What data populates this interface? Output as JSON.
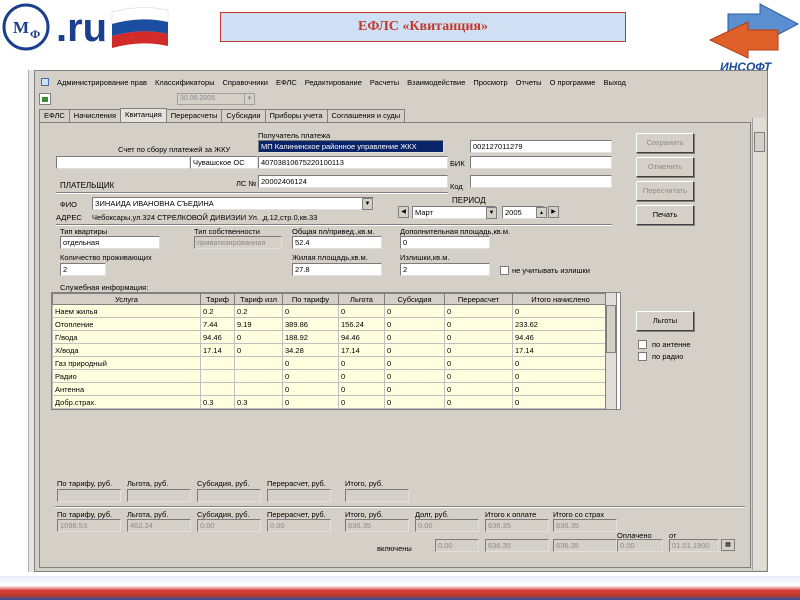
{
  "slide": {
    "title": "ЕФЛС «Квитанция»",
    "logo_left_text": ".ru",
    "logo_right_text": "ИНСОФТ"
  },
  "menu": [
    "Администрирование прав",
    "Классификаторы",
    "Справочники",
    "ЕФЛС",
    "Редактирование",
    "Расчеты",
    "Взаимодействие",
    "Просмотр",
    "Отчеты",
    "О программе",
    "Выход"
  ],
  "toolbar": {
    "date_value": "30.06.2005"
  },
  "tabs": [
    "ЕФЛС",
    "Начисления",
    "Квитанция",
    "Перерасчеты",
    "Субсидии",
    "Приборы учета",
    "Соглашения и суды"
  ],
  "form": {
    "recipient_label": "Получатель платежа",
    "recipient_value": "МП Калининское районное управление ЖКХ",
    "account_label": "Счет по сбору платежей за ЖКУ",
    "account_value": "40703810675220100113",
    "inn_value": "002127011279",
    "bank_value": "Чувашское ОС",
    "bik_label": "БИК",
    "payer_label": "ПЛАТЕЛЬЩИК",
    "ls_label": "ЛС №",
    "ls_value": "20002406124",
    "kod_label": "Код",
    "fio_label": "ФИО",
    "fio_value": "ЗИНАИДА ИВАНОВНА СЪЕДИНА",
    "address_label": "АДРЕС",
    "address_value": "Чебоксары,ул.324 СТРЕЛКОВОЙ ДИВИЗИИ Ул. ,д.12,стр.0,кв.33",
    "period_label": "ПЕРИОД",
    "period_month": "Март",
    "period_year": "2005",
    "apt_type_label": "Тип квартиры",
    "apt_type_value": "отдельная",
    "ownership_label": "Тип собственности",
    "ownership_value": "приватизированная",
    "total_area_label": "Общая пл/привед.,кв.м.",
    "total_area_value": "52.4",
    "extra_area_label": "Дополнительная площадь,кв.м.",
    "extra_area_value": "0",
    "residents_label": "Количество проживающих",
    "residents_value": "2",
    "living_area_label": "Жилая площадь,кв.м.",
    "living_area_value": "27.8",
    "surplus_label": "Излишки,кв.м.",
    "surplus_value": "2",
    "ignore_surplus_label": "не учитывать излишки",
    "service_info_label": "Служебная информация:"
  },
  "buttons": {
    "save": "Сохранить",
    "cancel": "Отменить",
    "recalc": "Пересчитать",
    "print": "Печать",
    "benefits": "Льготы",
    "by_antenna": "по антенне",
    "by_radio": "по радио"
  },
  "grid": {
    "columns": [
      "Услуга",
      "Тариф",
      "Тариф изл",
      "По тарифу",
      "Льгота",
      "Субсидия",
      "Перерасчет",
      "Итого начислено"
    ],
    "rows": [
      [
        "Наем жилья",
        "0.2",
        "0.2",
        "0",
        "0",
        "0",
        "0",
        "0"
      ],
      [
        "Отопление",
        "7.44",
        "9.19",
        "389.86",
        "156.24",
        "0",
        "0",
        "233.62"
      ],
      [
        "Г/вода",
        "94.46",
        "0",
        "188.92",
        "94.46",
        "0",
        "0",
        "94.46"
      ],
      [
        "Х/вода",
        "17.14",
        "0",
        "34.28",
        "17.14",
        "0",
        "0",
        "17.14"
      ],
      [
        "Газ природный",
        "",
        "",
        "0",
        "0",
        "0",
        "0",
        "0"
      ],
      [
        "Радио",
        "",
        "",
        "0",
        "0",
        "0",
        "0",
        "0"
      ],
      [
        "Антенна",
        "",
        "",
        "0",
        "0",
        "0",
        "0",
        "0"
      ],
      [
        "Добр.страх.",
        "0.3",
        "0.3",
        "0",
        "0",
        "0",
        "0",
        "0"
      ]
    ]
  },
  "totals1": {
    "labels": [
      "По тарифу, руб.",
      "Льгота, руб.",
      "Субсидия, руб.",
      "Перерасчет, руб.",
      "Итого, руб."
    ],
    "values": [
      "",
      "",
      "",
      "",
      ""
    ]
  },
  "totals2": {
    "labels": [
      "По тарифу, руб.",
      "Льгота, руб.",
      "Субсидия, руб.",
      "Перерасчет, руб.",
      "Итого, руб.",
      "Долг, руб.",
      "Итого к оплате",
      "Итого со страх"
    ],
    "values": [
      "1098.53",
      "462.24",
      "0.00",
      "0.00",
      "636.35",
      "0.00",
      "636.35",
      "636.35"
    ]
  },
  "included": {
    "label": "включены",
    "values": [
      "0.00",
      "636.35",
      "636.35"
    ],
    "paid_label": "Оплачено",
    "paid_value": "0.00",
    "from_label": "от",
    "from_value": "01.01.1900"
  }
}
